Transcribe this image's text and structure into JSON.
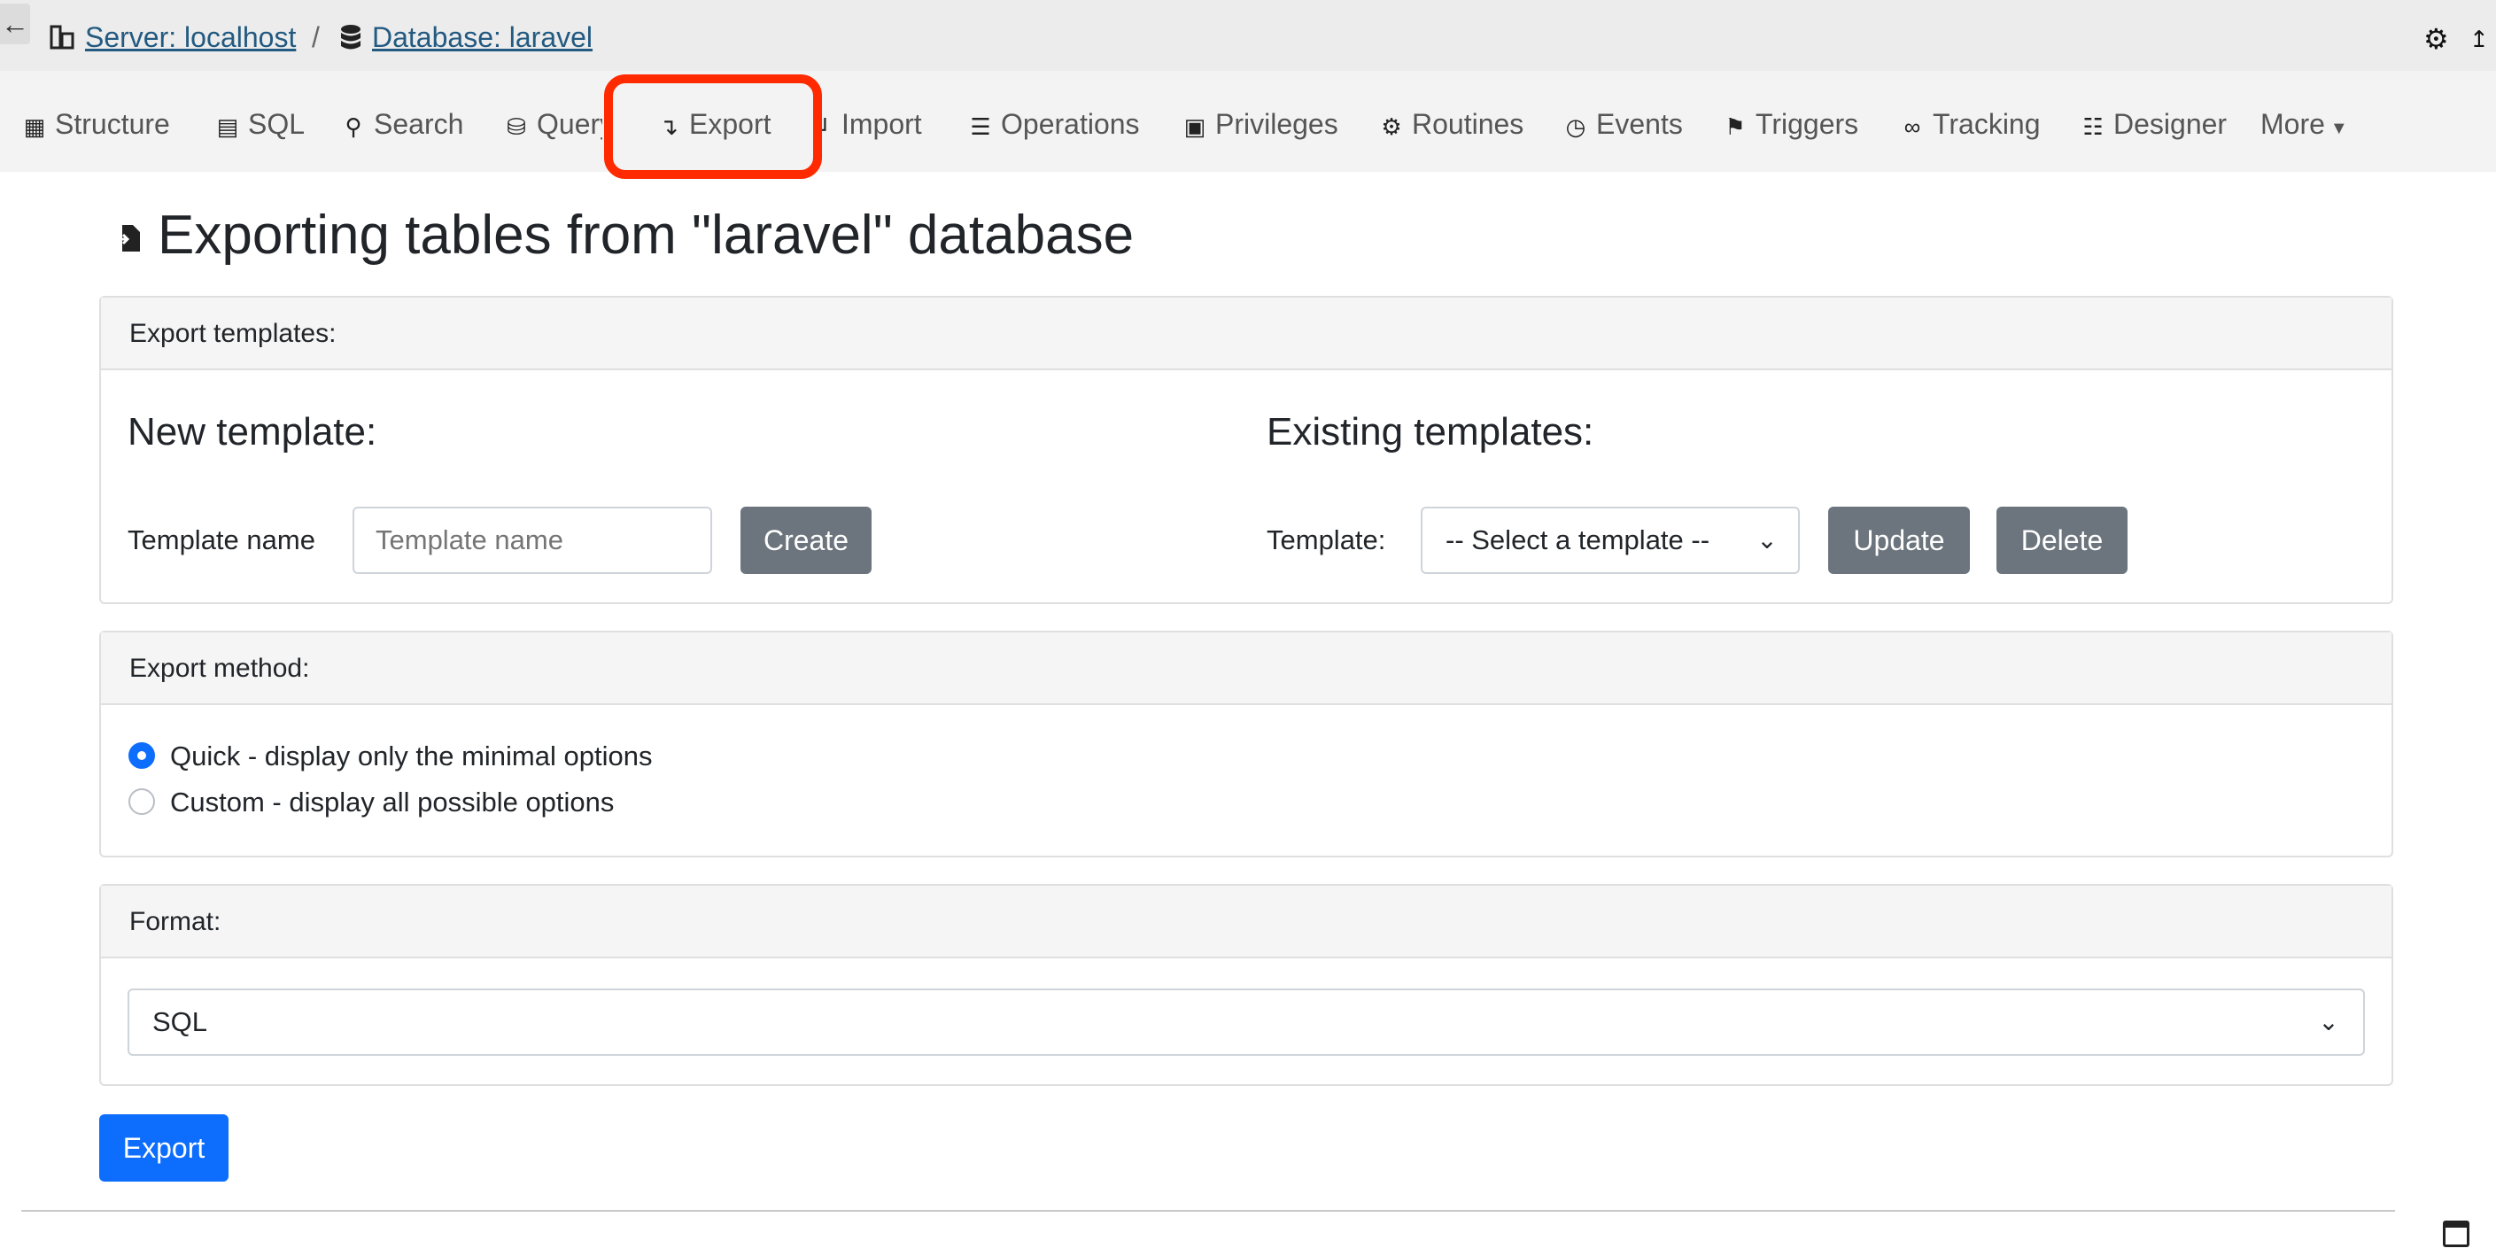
{
  "breadcrumb": {
    "back_icon": "left-arrow-icon",
    "server": "Server: localhost",
    "separator": "/",
    "database": "Database: laravel"
  },
  "top_right": {
    "settings_icon": "gear-icon",
    "collapse_icon": "collapse-icon"
  },
  "tabs": [
    {
      "label": "Structure",
      "icon": "table-icon"
    },
    {
      "label": "SQL",
      "icon": "sql-icon"
    },
    {
      "label": "Search",
      "icon": "search-icon"
    },
    {
      "label": "Query",
      "icon": "database-icon"
    },
    {
      "label": "Export",
      "icon": "export-icon",
      "highlighted": true
    },
    {
      "label": "Import",
      "icon": "import-icon"
    },
    {
      "label": "Operations",
      "icon": "operations-icon"
    },
    {
      "label": "Privileges",
      "icon": "privileges-icon"
    },
    {
      "label": "Routines",
      "icon": "routines-icon"
    },
    {
      "label": "Events",
      "icon": "clock-icon"
    },
    {
      "label": "Triggers",
      "icon": "flag-icon"
    },
    {
      "label": "Tracking",
      "icon": "glasses-icon"
    },
    {
      "label": "Designer",
      "icon": "designer-icon"
    },
    {
      "label": "More",
      "icon": "caret-down-icon"
    }
  ],
  "page": {
    "title": "Exporting tables from \"laravel\" database"
  },
  "templates_card": {
    "header": "Export templates:",
    "new_heading": "New template:",
    "name_label": "Template name",
    "name_placeholder": "Template name",
    "create_button": "Create",
    "existing_heading": "Existing templates:",
    "template_label": "Template:",
    "template_select": "-- Select a template --",
    "update_button": "Update",
    "delete_button": "Delete"
  },
  "method_card": {
    "header": "Export method:",
    "options": [
      {
        "label": "Quick - display only the minimal options",
        "checked": true
      },
      {
        "label": "Custom - display all possible options",
        "checked": false
      }
    ]
  },
  "format_card": {
    "header": "Format:",
    "selected": "SQL"
  },
  "export_button": "Export",
  "colors": {
    "accent": "#0d6efd",
    "link": "#235a81",
    "secondary": "#6c757d",
    "highlight": "#ff2a00"
  }
}
